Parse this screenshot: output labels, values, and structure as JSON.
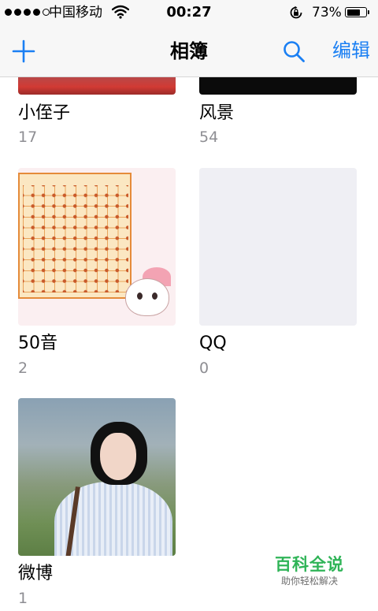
{
  "status_bar": {
    "carrier": "中国移动",
    "time": "00:27",
    "battery_percent": "73%",
    "battery_level": 0.73,
    "signal_icon": "signal-dots-icon",
    "wifi_icon": "wifi-icon",
    "lock_icon": "orientation-lock-icon"
  },
  "nav": {
    "title": "相簿",
    "edit_label": "编辑",
    "add_icon": "plus-icon",
    "search_icon": "search-icon",
    "accent_color": "#1a7ff3"
  },
  "albums": [
    {
      "name": "小侄子",
      "count": "17"
    },
    {
      "name": "风景",
      "count": "54"
    },
    {
      "name": "50音",
      "count": "2"
    },
    {
      "name": "QQ",
      "count": "0"
    },
    {
      "name": "微博",
      "count": "1"
    }
  ],
  "watermark": {
    "title": "百科全说",
    "subtitle": "助你轻松解决"
  }
}
